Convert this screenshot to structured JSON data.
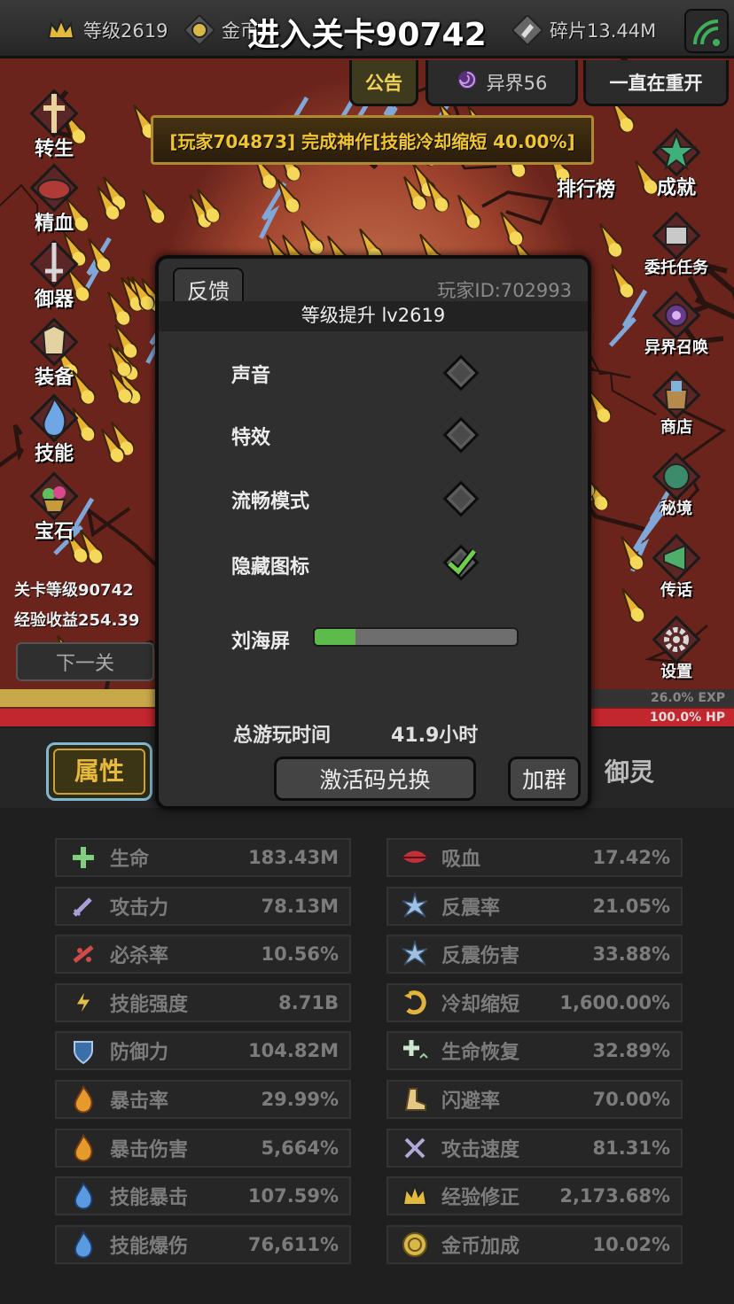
{
  "top_bar": {
    "level": "等级2619",
    "gold": "金币",
    "stage_title": "进入关卡90742",
    "shards": "碎片13.44M"
  },
  "tabs": {
    "notice": "公告",
    "otherworld": "异界56",
    "restart": "一直在重开"
  },
  "announcement": "[玩家704873] 完成神作[技能冷却缩短 40.00%]",
  "left_menu": [
    "转生",
    "精血",
    "御器",
    "装备",
    "技能",
    "宝石"
  ],
  "right_menu": [
    "排行榜",
    "成就",
    "委托任务",
    "异界召唤",
    "商店",
    "秘境",
    "传话",
    "设置"
  ],
  "stage_info": {
    "stage_level": "关卡等级90742",
    "exp_gain": "经验收益254.39"
  },
  "next_stage_label": "下一关",
  "bars": {
    "exp_text": "26.0% EXP",
    "exp_fraction": 0.26,
    "hp_text": "100.0% HP",
    "hp_fraction": 1.0
  },
  "bottom_tabs": {
    "attributes": "属性",
    "spirit": "御灵"
  },
  "settings": {
    "feedback": "反馈",
    "player_id": "玩家ID:702993",
    "level_up": "等级提升 lv2619",
    "options": [
      {
        "label": "声音",
        "checked": false
      },
      {
        "label": "特效",
        "checked": false
      },
      {
        "label": "流畅模式",
        "checked": false
      },
      {
        "label": "隐藏图标",
        "checked": true
      }
    ],
    "notch_label": "刘海屏",
    "notch_value": 0.2,
    "playtime_label": "总游玩时间",
    "playtime_value": "41.9小时",
    "redeem": "激活码兑换",
    "join_group": "加群"
  },
  "stats_left": [
    {
      "name": "生命",
      "value": "183.43M",
      "icon": "cross-icon"
    },
    {
      "name": "攻击力",
      "value": "78.13M",
      "icon": "sword-icon"
    },
    {
      "name": "必杀率",
      "value": "10.56%",
      "icon": "slash-icon"
    },
    {
      "name": "技能强度",
      "value": "8.71B",
      "icon": "lightning-icon"
    },
    {
      "name": "防御力",
      "value": "104.82M",
      "icon": "shield-icon"
    },
    {
      "name": "暴击率",
      "value": "29.99%",
      "icon": "flame-icon"
    },
    {
      "name": "暴击伤害",
      "value": "5,664%",
      "icon": "flame-icon"
    },
    {
      "name": "技能暴击",
      "value": "107.59%",
      "icon": "blue-flame-icon"
    },
    {
      "name": "技能爆伤",
      "value": "76,611%",
      "icon": "blue-flame-icon"
    }
  ],
  "stats_right": [
    {
      "name": "吸血",
      "value": "17.42%",
      "icon": "lips-icon"
    },
    {
      "name": "反震率",
      "value": "21.05%",
      "icon": "spike-icon"
    },
    {
      "name": "反震伤害",
      "value": "33.88%",
      "icon": "spike-icon"
    },
    {
      "name": "冷却缩短",
      "value": "1,600.00%",
      "icon": "cooldown-icon"
    },
    {
      "name": "生命恢复",
      "value": "32.89%",
      "icon": "heal-icon"
    },
    {
      "name": "闪避率",
      "value": "70.00%",
      "icon": "boot-icon"
    },
    {
      "name": "攻击速度",
      "value": "81.31%",
      "icon": "swords-icon"
    },
    {
      "name": "经验修正",
      "value": "2,173.68%",
      "icon": "crown-icon"
    },
    {
      "name": "金币加成",
      "value": "10.02%",
      "icon": "coin-icon"
    }
  ],
  "colors": {
    "gold_text": "#f1c531",
    "hp_red": "#c2262e",
    "exp_gold": "#c8a94a",
    "toggle_green": "#5dbb4b"
  }
}
